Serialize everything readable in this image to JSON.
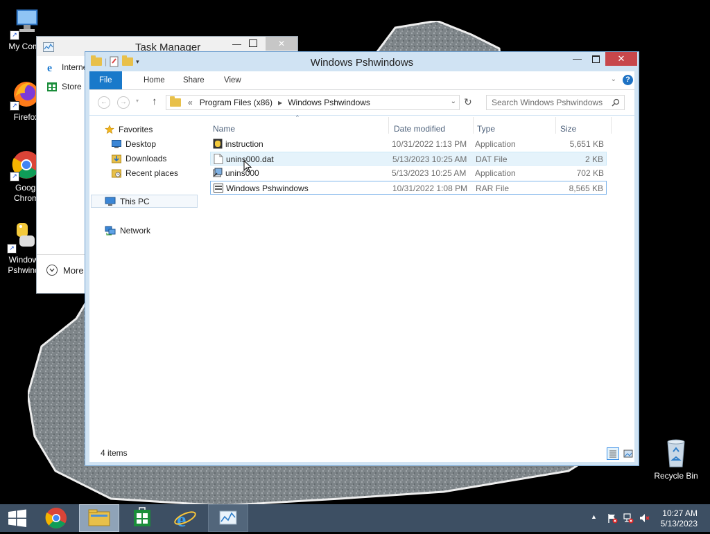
{
  "desktop": {
    "icons": [
      {
        "label": "My Comp",
        "icon": "computer-icon"
      },
      {
        "label": "Firefox",
        "icon": "firefox-icon"
      },
      {
        "label": "Google Chrome",
        "line1": "Googl",
        "line2": "Chrom",
        "icon": "chrome-icon"
      },
      {
        "label": "Windows Pshwindows",
        "line1": "Window",
        "line2": "Pshwind",
        "icon": "python-icon"
      },
      {
        "label": "Recycle Bin",
        "icon": "recycle-bin-icon"
      }
    ]
  },
  "task_manager": {
    "title": "Task Manager",
    "apps": [
      "Interne",
      "Store"
    ],
    "more_label": "More"
  },
  "explorer": {
    "title": "Windows Pshwindows",
    "ribbon_tabs": [
      "File",
      "Home",
      "Share",
      "View"
    ],
    "breadcrumb": {
      "prefix": "«",
      "parts": [
        "Program Files (x86)",
        "Windows Pshwindows"
      ]
    },
    "search_placeholder": "Search Windows Pshwindows",
    "nav": {
      "favorites": "Favorites",
      "favorites_items": [
        "Desktop",
        "Downloads",
        "Recent places"
      ],
      "this_pc": "This PC",
      "network": "Network"
    },
    "columns": {
      "name": "Name",
      "date": "Date modified",
      "type": "Type",
      "size": "Size"
    },
    "files": [
      {
        "name": "instruction",
        "date": "10/31/2022 1:13 PM",
        "type": "Application",
        "size": "5,651 KB",
        "icon": "application-icon"
      },
      {
        "name": "unins000.dat",
        "date": "5/13/2023 10:25 AM",
        "type": "DAT File",
        "size": "2 KB",
        "icon": "file-icon"
      },
      {
        "name": "unins000",
        "date": "5/13/2023 10:25 AM",
        "type": "Application",
        "size": "702 KB",
        "icon": "uninstaller-icon"
      },
      {
        "name": "Windows Pshwindows",
        "date": "10/31/2022 1:08 PM",
        "type": "RAR File",
        "size": "8,565 KB",
        "icon": "archive-icon"
      }
    ],
    "status": "4 items"
  },
  "taskbar": {
    "time": "10:27 AM",
    "date": "5/13/2023"
  },
  "colors": {
    "accent": "#1979ca",
    "taskbar": "#3d4f63",
    "selection": "#e5f3fb",
    "close": "#c7474b"
  }
}
